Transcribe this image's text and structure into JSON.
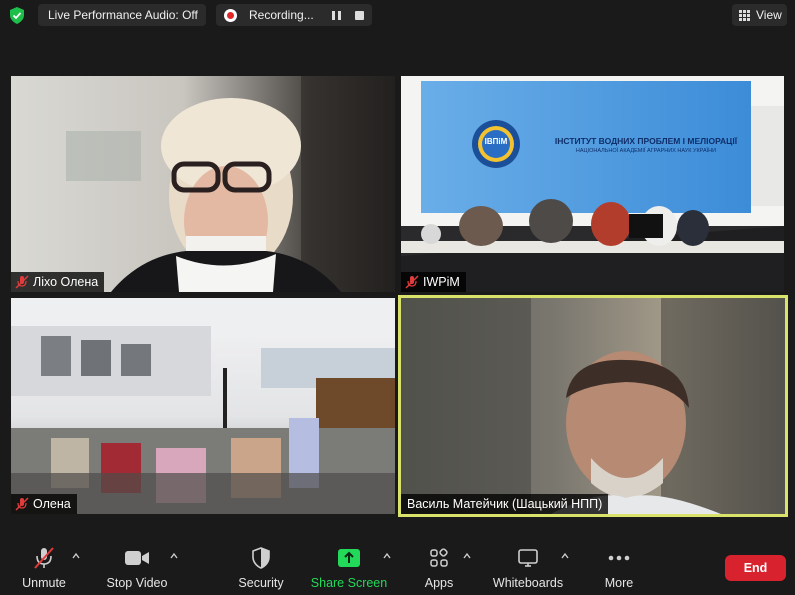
{
  "topbar": {
    "security_icon": "shield-check-icon",
    "audio_status": "Live Performance Audio: Off",
    "recording_label": "Recording...",
    "view_label": "View",
    "colors": {
      "shield": "#1dbf4a",
      "record": "#e02828"
    }
  },
  "participants": [
    {
      "name": "Ліхо Олена",
      "muted": true
    },
    {
      "name": "IWPiM",
      "muted": true
    },
    {
      "name": "Олена",
      "muted": true
    },
    {
      "name": "Василь Матейчик (Шацький НПП)",
      "muted": false,
      "active_speaker": true
    }
  ],
  "room_banner": {
    "logo_text": "ІВПіМ",
    "title": "ІНСТИТУТ ВОДНИХ ПРОБЛЕМ І МЕЛІОРАЦІЇ",
    "subtitle": "НАЦІОНАЛЬНОЇ АКАДЕМІЇ АГРАРНИХ НАУК УКРАЇНИ"
  },
  "toolbar": {
    "unmute": "Unmute",
    "stop_video": "Stop Video",
    "security": "Security",
    "share_screen": "Share Screen",
    "apps": "Apps",
    "whiteboards": "Whiteboards",
    "more": "More",
    "end": "End",
    "colors": {
      "share": "#23d959",
      "end": "#d8232f",
      "active_speaker_border": "#d9e26a"
    }
  }
}
